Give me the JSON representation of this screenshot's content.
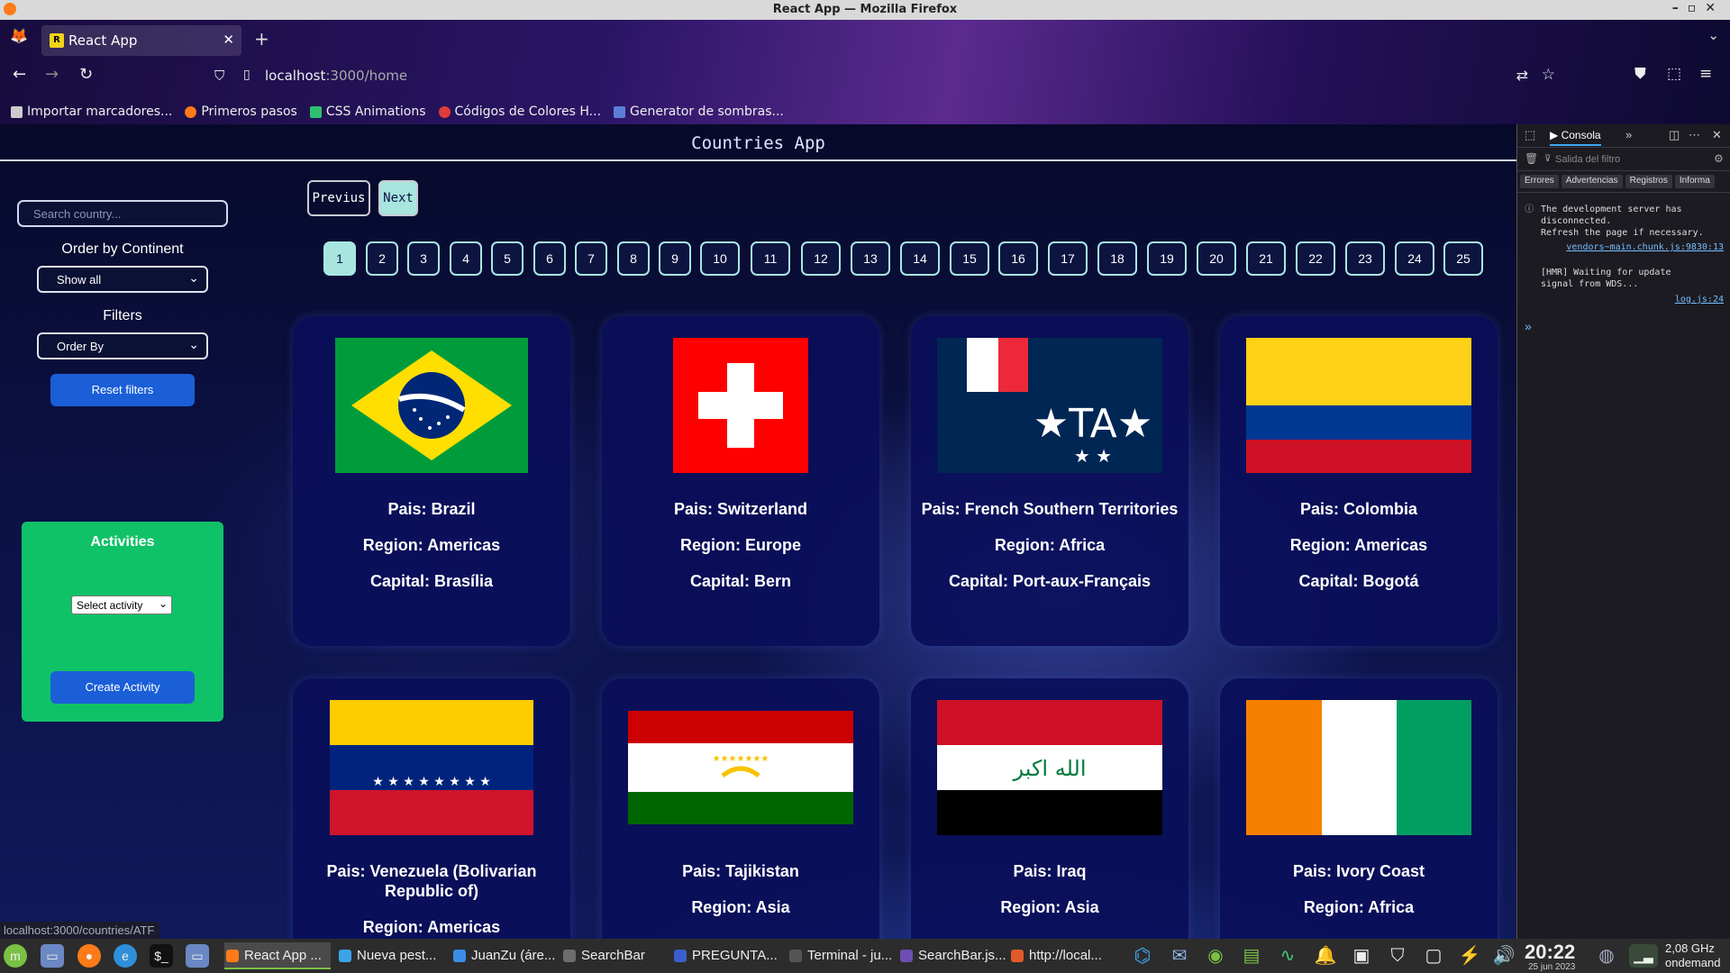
{
  "window": {
    "title": "React App — Mozilla Firefox"
  },
  "browser": {
    "tab_title": "React App",
    "url_host": "localhost",
    "url_rest": ":3000/home",
    "bookmarks": [
      {
        "label": "Importar marcadores...",
        "color": "#cccccc"
      },
      {
        "label": "Primeros pasos",
        "color": "#ff7a18"
      },
      {
        "label": "CSS Animations",
        "color": "#2fbf71"
      },
      {
        "label": "Códigos de Colores H...",
        "color": "#e23b3b"
      },
      {
        "label": "Generator de sombras...",
        "color": "#5b7fd6"
      }
    ]
  },
  "app": {
    "title": "Countries App",
    "search_placeholder": "Search country...",
    "order_continent_label": "Order by Continent",
    "continent_select_value": "Show all",
    "filters_label": "Filters",
    "order_select_value": "Order By",
    "reset_label": "Reset filters",
    "activities": {
      "title": "Activities",
      "select_value": "Select activity",
      "create_label": "Create Activity"
    },
    "prev_label": "Previus",
    "next_label": "Next",
    "pages": [
      "1",
      "2",
      "3",
      "4",
      "5",
      "6",
      "7",
      "8",
      "9",
      "10",
      "11",
      "12",
      "13",
      "14",
      "15",
      "16",
      "17",
      "18",
      "19",
      "20",
      "21",
      "22",
      "23",
      "24",
      "25"
    ],
    "active_page": "1",
    "countries": [
      {
        "pais": "Pais: Brazil",
        "region": "Region: Americas",
        "capital": "Capital: Brasília",
        "flag": "br"
      },
      {
        "pais": "Pais: Switzerland",
        "region": "Region: Europe",
        "capital": "Capital: Bern",
        "flag": "ch"
      },
      {
        "pais": "Pais: French Southern Territories",
        "region": "Region: Africa",
        "capital": "Capital: Port-aux-Français",
        "flag": "tf"
      },
      {
        "pais": "Pais: Colombia",
        "region": "Region: Americas",
        "capital": "Capital: Bogotá",
        "flag": "co"
      },
      {
        "pais": "Pais: Venezuela (Bolivarian Republic of)",
        "region": "Region: Americas",
        "flag": "ve"
      },
      {
        "pais": "Pais: Tajikistan",
        "region": "Region: Asia",
        "flag": "tj"
      },
      {
        "pais": "Pais: Iraq",
        "region": "Region: Asia",
        "flag": "iq"
      },
      {
        "pais": "Pais: Ivory Coast",
        "region": "Region: Africa",
        "flag": "ci"
      }
    ],
    "iraq_flag_text": "الله اكبر",
    "status_url": "localhost:3000/countries/ATF"
  },
  "devtools": {
    "console_tab": "Consola",
    "filter_placeholder": "Salida del filtro",
    "categories": [
      "Errores",
      "Advertencias",
      "Registros",
      "Informa"
    ],
    "msg1": "The development server has\ndisconnected.\nRefresh the page if necessary.",
    "msg1_src": "vendors~main.chunk.js:9830:13",
    "msg2": "[HMR] Waiting for update\nsignal from WDS...",
    "msg2_src": "log.js:24"
  },
  "taskbar": {
    "tasks": [
      {
        "label": "React App ...",
        "color": "#ff7a18",
        "active": true
      },
      {
        "label": "Nueva pest...",
        "color": "#3ba3e6",
        "active": false
      },
      {
        "label": "JuanZu (áre...",
        "color": "#3b8de6",
        "active": false
      },
      {
        "label": "SearchBar",
        "color": "#6d6d6d",
        "active": false
      },
      {
        "label": "PREGUNTA...",
        "color": "#3a5fcd",
        "active": false
      },
      {
        "label": "Terminal - ju...",
        "color": "#555555",
        "active": false
      },
      {
        "label": "SearchBar.js...",
        "color": "#6d4fb3",
        "active": false
      },
      {
        "label": "http://local...",
        "color": "#e25a2b",
        "active": false
      }
    ],
    "time": "20:22",
    "date": "25 jun 2023",
    "cpu_freq": "2,08 GHz",
    "cpu_governor": "ondemand"
  }
}
